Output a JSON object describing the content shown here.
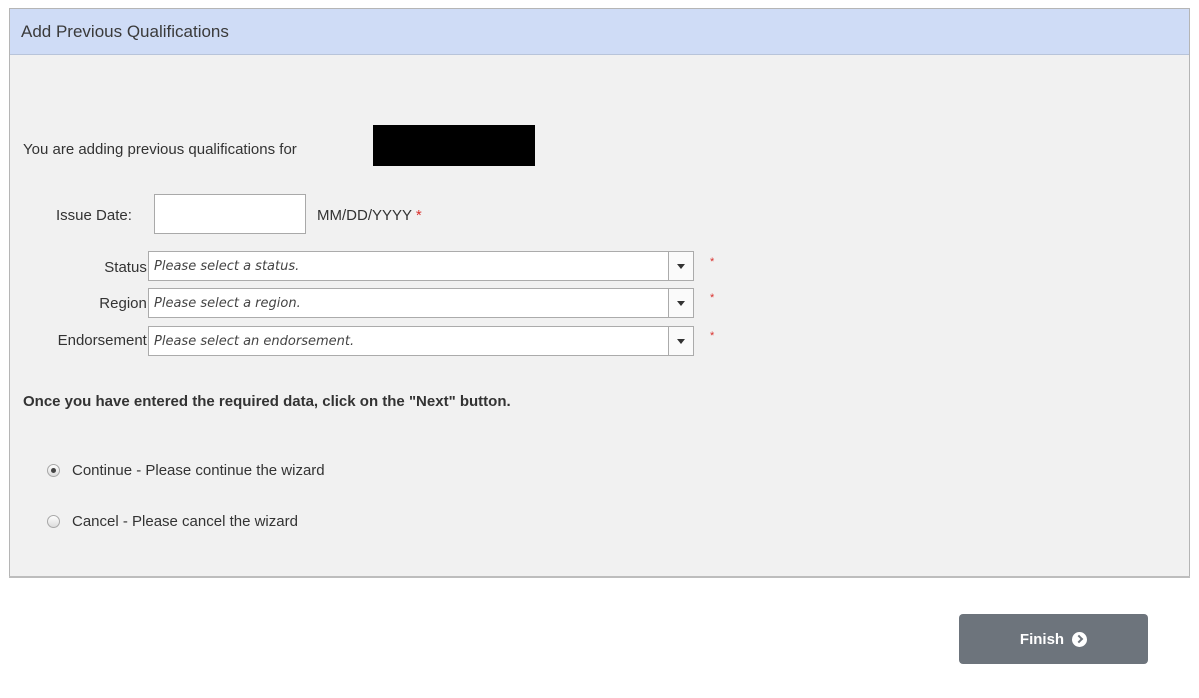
{
  "panel": {
    "title": "Add Previous Qualifications"
  },
  "intro": {
    "text": "You are adding previous qualifications for"
  },
  "form": {
    "issue_date": {
      "label": "Issue Date:",
      "value": "",
      "hint": "MM/DD/YYYY",
      "required_mark": "*"
    },
    "status": {
      "label": "Status:",
      "placeholder": "Please select a status.",
      "required_mark": "*",
      "icon": "chevron-down-icon"
    },
    "region": {
      "label": "Region:",
      "placeholder": "Please select a region.",
      "required_mark": "*",
      "icon": "chevron-down-icon"
    },
    "endorsement": {
      "label": "Endorsement:",
      "placeholder": "Please select an endorsement.",
      "required_mark": "*",
      "icon": "chevron-down-icon"
    }
  },
  "instruction": "Once you have entered the required data, click on the \"Next\" button.",
  "options": [
    {
      "label": "Continue - Please continue the wizard",
      "selected": true
    },
    {
      "label": "Cancel - Please cancel the wizard",
      "selected": false
    }
  ],
  "footer": {
    "finish_label": "Finish",
    "finish_icon": "chevron-circle-right-icon"
  },
  "colors": {
    "header_bg": "#cfdcf6",
    "panel_bg": "#f1f1f1",
    "required": "#d9302c",
    "button_bg": "#6d747c"
  }
}
